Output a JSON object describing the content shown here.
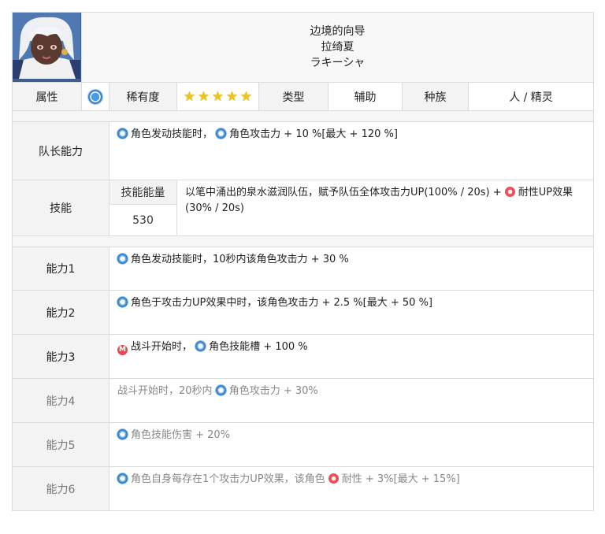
{
  "character": {
    "title": "边境的向导",
    "name_cn": "拉绮夏",
    "name_jp": "ラキーシャ"
  },
  "info_row": {
    "attribute_label": "属性",
    "rarity_label": "稀有度",
    "rarity_stars": 5,
    "type_label": "类型",
    "type_value": "辅助",
    "race_label": "种族",
    "race_value": "人 / 精灵"
  },
  "leader": {
    "label": "队长能力",
    "text_a": "角色发动技能时，",
    "text_b": "角色攻击力 + 10 %[最大 + 120 %]"
  },
  "skill": {
    "label": "技能",
    "energy_label": "技能能量",
    "energy_value": "530",
    "text_a": "以笔中涌出的泉水滋润队伍，赋予队伍全体攻击力UP(100% / 20s) + ",
    "text_b": "耐性UP效果(30% / 20s)"
  },
  "abilities": [
    {
      "label": "能力1",
      "text_a": "角色发动技能时，10秒内该角色攻击力 + 30 %"
    },
    {
      "label": "能力2",
      "text_a": "角色于攻击力UP效果中时，该角色攻击力 + 2.5 %[最大 + 50 %]"
    },
    {
      "label": "能力3",
      "text_a": "战斗开始时，",
      "text_b": "角色技能槽 + 100 %"
    },
    {
      "label": "能力4",
      "text_a": "战斗开始时，20秒内 ",
      "text_b": "角色攻击力 + 30%"
    },
    {
      "label": "能力5",
      "text_a": "角色技能伤害 + 20%"
    },
    {
      "label": "能力6",
      "text_a": "角色自身每存在1个攻击力UP效果，该角色 ",
      "text_b": "耐性 + 3%[最大 + 15%]"
    }
  ],
  "icons": {
    "attribute": "blue-ring-icon",
    "attack": "blue-ring-icon",
    "defense": "red-flame-icon",
    "battle": "red-m-icon",
    "rarity": "rainbow-star-icon"
  },
  "colors": {
    "label_bg": "#f3f3f3",
    "border": "#dcdcdc",
    "blue_icon": "#3b7fd0",
    "red_icon": "#e24c55",
    "dim_text": "#888888"
  }
}
